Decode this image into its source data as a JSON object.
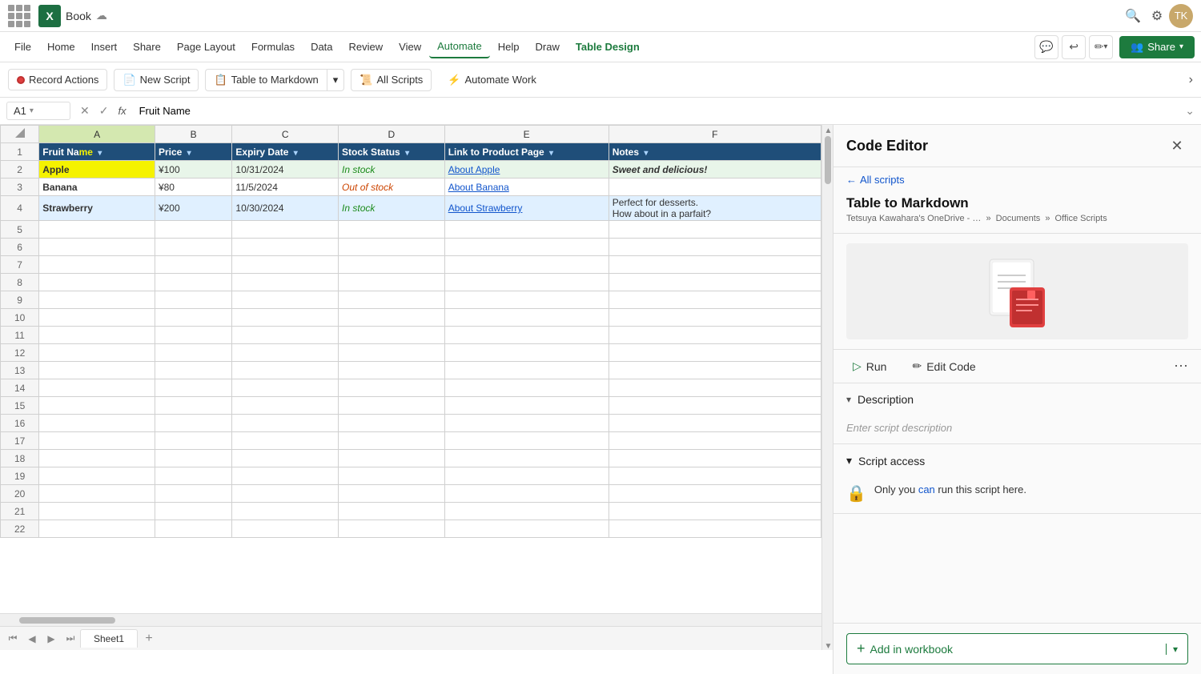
{
  "titleBar": {
    "appIcon": "X",
    "fileName": "Book",
    "searchTitle": "Search",
    "settingsTitle": "Settings"
  },
  "menuBar": {
    "items": [
      {
        "label": "File",
        "active": false
      },
      {
        "label": "Home",
        "active": false
      },
      {
        "label": "Insert",
        "active": false
      },
      {
        "label": "Share",
        "active": false
      },
      {
        "label": "Page Layout",
        "active": false
      },
      {
        "label": "Formulas",
        "active": false
      },
      {
        "label": "Data",
        "active": false
      },
      {
        "label": "Review",
        "active": false
      },
      {
        "label": "View",
        "active": false
      },
      {
        "label": "Automate",
        "active": true
      },
      {
        "label": "Help",
        "active": false
      },
      {
        "label": "Draw",
        "active": false
      },
      {
        "label": "Table Design",
        "active": false
      }
    ],
    "shareLabel": "Share"
  },
  "toolbar": {
    "recordActions": "Record Actions",
    "newScript": "New Script",
    "tableToMarkdown": "Table to Markdown",
    "allScripts": "All Scripts",
    "automateWork": "Automate Work"
  },
  "formulaBar": {
    "cellRef": "A1",
    "formula": "Fruit Name"
  },
  "columns": [
    "A",
    "B",
    "C",
    "D",
    "E",
    "F"
  ],
  "rows": [
    {
      "num": 1,
      "isHeader": true,
      "cells": [
        "Fruit Name",
        "Price",
        "Expiry Date",
        "Stock Status",
        "Link to Product Page",
        "Notes"
      ]
    },
    {
      "num": 2,
      "cells": [
        "Apple",
        "¥100",
        "10/31/2024",
        "In stock",
        "About Apple",
        "Sweet and delicious!"
      ]
    },
    {
      "num": 3,
      "cells": [
        "Banana",
        "¥80",
        "11/5/2024",
        "Out of stock",
        "About Banana",
        ""
      ]
    },
    {
      "num": 4,
      "cells": [
        "Strawberry",
        "¥200",
        "10/30/2024",
        "In stock",
        "About Strawberry",
        "Perfect for desserts.\nHow about in a parfait?"
      ]
    },
    {
      "num": 5,
      "cells": [
        "",
        "",
        "",
        "",
        "",
        ""
      ]
    },
    {
      "num": 6,
      "cells": [
        "",
        "",
        "",
        "",
        "",
        ""
      ]
    },
    {
      "num": 7,
      "cells": [
        "",
        "",
        "",
        "",
        "",
        ""
      ]
    },
    {
      "num": 8,
      "cells": [
        "",
        "",
        "",
        "",
        "",
        ""
      ]
    },
    {
      "num": 9,
      "cells": [
        "",
        "",
        "",
        "",
        "",
        ""
      ]
    },
    {
      "num": 10,
      "cells": [
        "",
        "",
        "",
        "",
        "",
        ""
      ]
    },
    {
      "num": 11,
      "cells": [
        "",
        "",
        "",
        "",
        "",
        ""
      ]
    },
    {
      "num": 12,
      "cells": [
        "",
        "",
        "",
        "",
        "",
        ""
      ]
    },
    {
      "num": 13,
      "cells": [
        "",
        "",
        "",
        "",
        "",
        ""
      ]
    },
    {
      "num": 14,
      "cells": [
        "",
        "",
        "",
        "",
        "",
        ""
      ]
    },
    {
      "num": 15,
      "cells": [
        "",
        "",
        "",
        "",
        "",
        ""
      ]
    },
    {
      "num": 16,
      "cells": [
        "",
        "",
        "",
        "",
        "",
        ""
      ]
    },
    {
      "num": 17,
      "cells": [
        "",
        "",
        "",
        "",
        "",
        ""
      ]
    },
    {
      "num": 18,
      "cells": [
        "",
        "",
        "",
        "",
        "",
        ""
      ]
    },
    {
      "num": 19,
      "cells": [
        "",
        "",
        "",
        "",
        "",
        ""
      ]
    },
    {
      "num": 20,
      "cells": [
        "",
        "",
        "",
        "",
        "",
        ""
      ]
    },
    {
      "num": 21,
      "cells": [
        "",
        "",
        "",
        "",
        "",
        ""
      ]
    },
    {
      "num": 22,
      "cells": [
        "",
        "",
        "",
        "",
        "",
        ""
      ]
    }
  ],
  "sheet": {
    "tab": "Sheet1"
  },
  "codeEditor": {
    "title": "Code Editor",
    "backLabel": "All scripts",
    "scriptName": "Table to Markdown",
    "pathPart1": "Tetsuya Kawahara's OneDrive - …",
    "pathSep1": "»",
    "pathPart2": "Documents",
    "pathSep2": "»",
    "pathPart3": "Office Scripts",
    "runLabel": "Run",
    "editCodeLabel": "Edit Code",
    "descriptionSection": "Description",
    "descriptionPlaceholder": "Enter script description",
    "scriptAccessSection": "Script access",
    "accessText": "Only you can run this script here.",
    "addInWorkbook": "Add in workbook"
  }
}
